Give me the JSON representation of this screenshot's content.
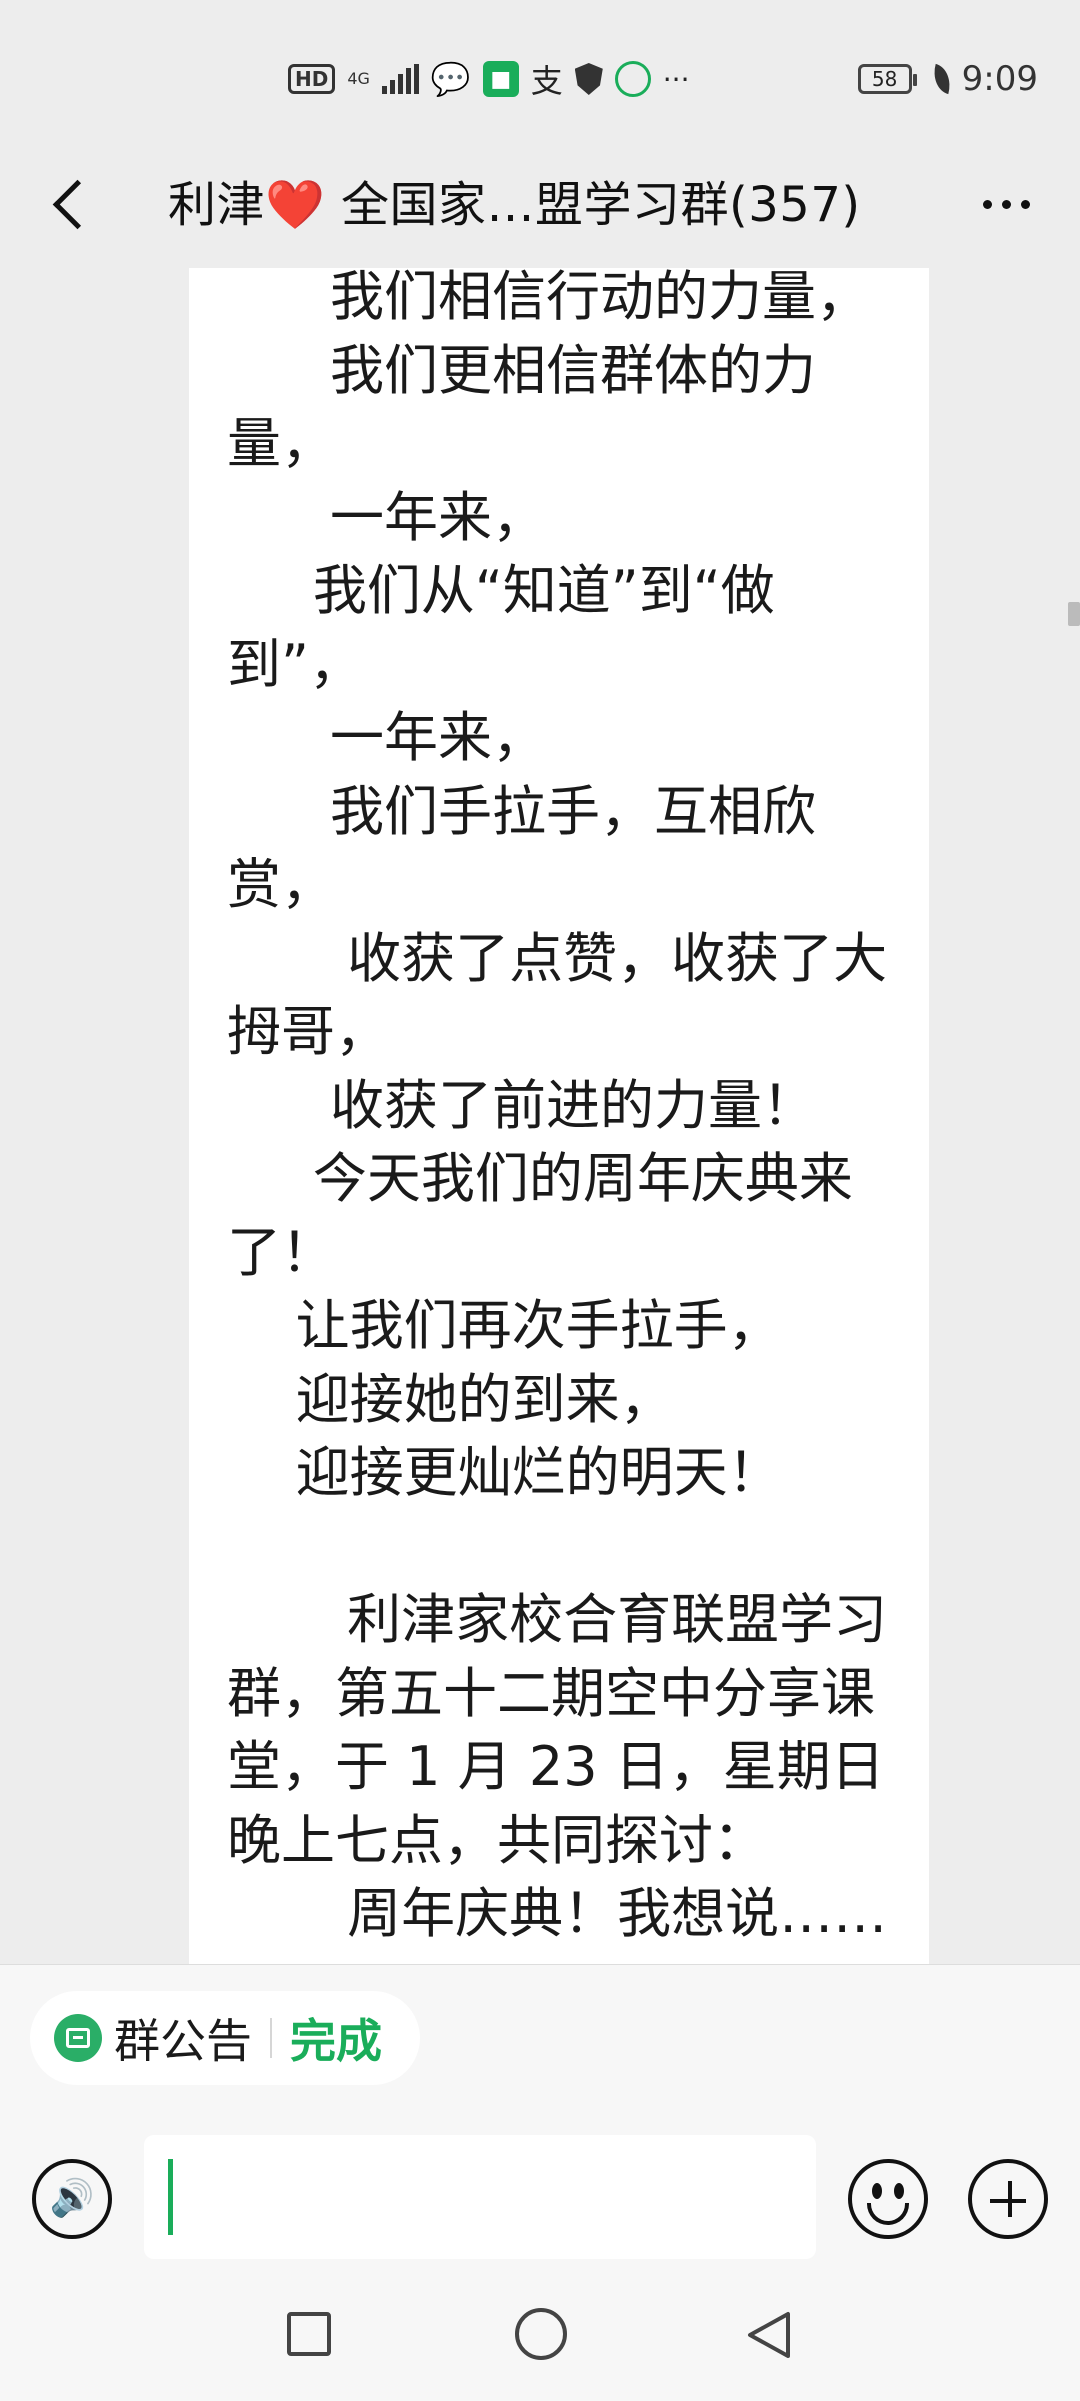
{
  "status_bar": {
    "hd": "HD",
    "network": "4G",
    "battery": "58",
    "time": "9:09",
    "icons": [
      "hd-icon",
      "signal-icon",
      "wechat-icon",
      "shield-app-icon",
      "alipay-icon",
      "security-shield-icon",
      "app-circle-icon",
      "more-dots-icon",
      "battery-icon",
      "leaf-icon"
    ]
  },
  "header": {
    "title_prefix": "利津",
    "title_heart": "❤️",
    "title_rest": " 全国家…盟学习群(357)"
  },
  "notice": {
    "text": "      我们相信行动的力量，\n      我们更相信群体的力量，\n      一年来，\n     我们从“知道”到“做到”，\n      一年来，\n      我们手拉手，互相欣赏，\n       收获了点赞，收获了大拇哥，\n      收获了前进的力量！\n     今天我们的周年庆典来了！\n    让我们再次手拉手，\n    迎接她的到来，\n    迎接更灿烂的明天！\n\n       利津家校合育联盟学习群，第五十二期空中分享课堂，于 1 月 23 日，星期日晚上七点，共同探讨：\n       周年庆典！我想说……"
  },
  "bottom": {
    "pill_label": "群公告",
    "pill_done": "完成"
  },
  "colors": {
    "accent_green": "#1aad5a",
    "heart_red": "#e0202c",
    "background": "#ededed"
  }
}
